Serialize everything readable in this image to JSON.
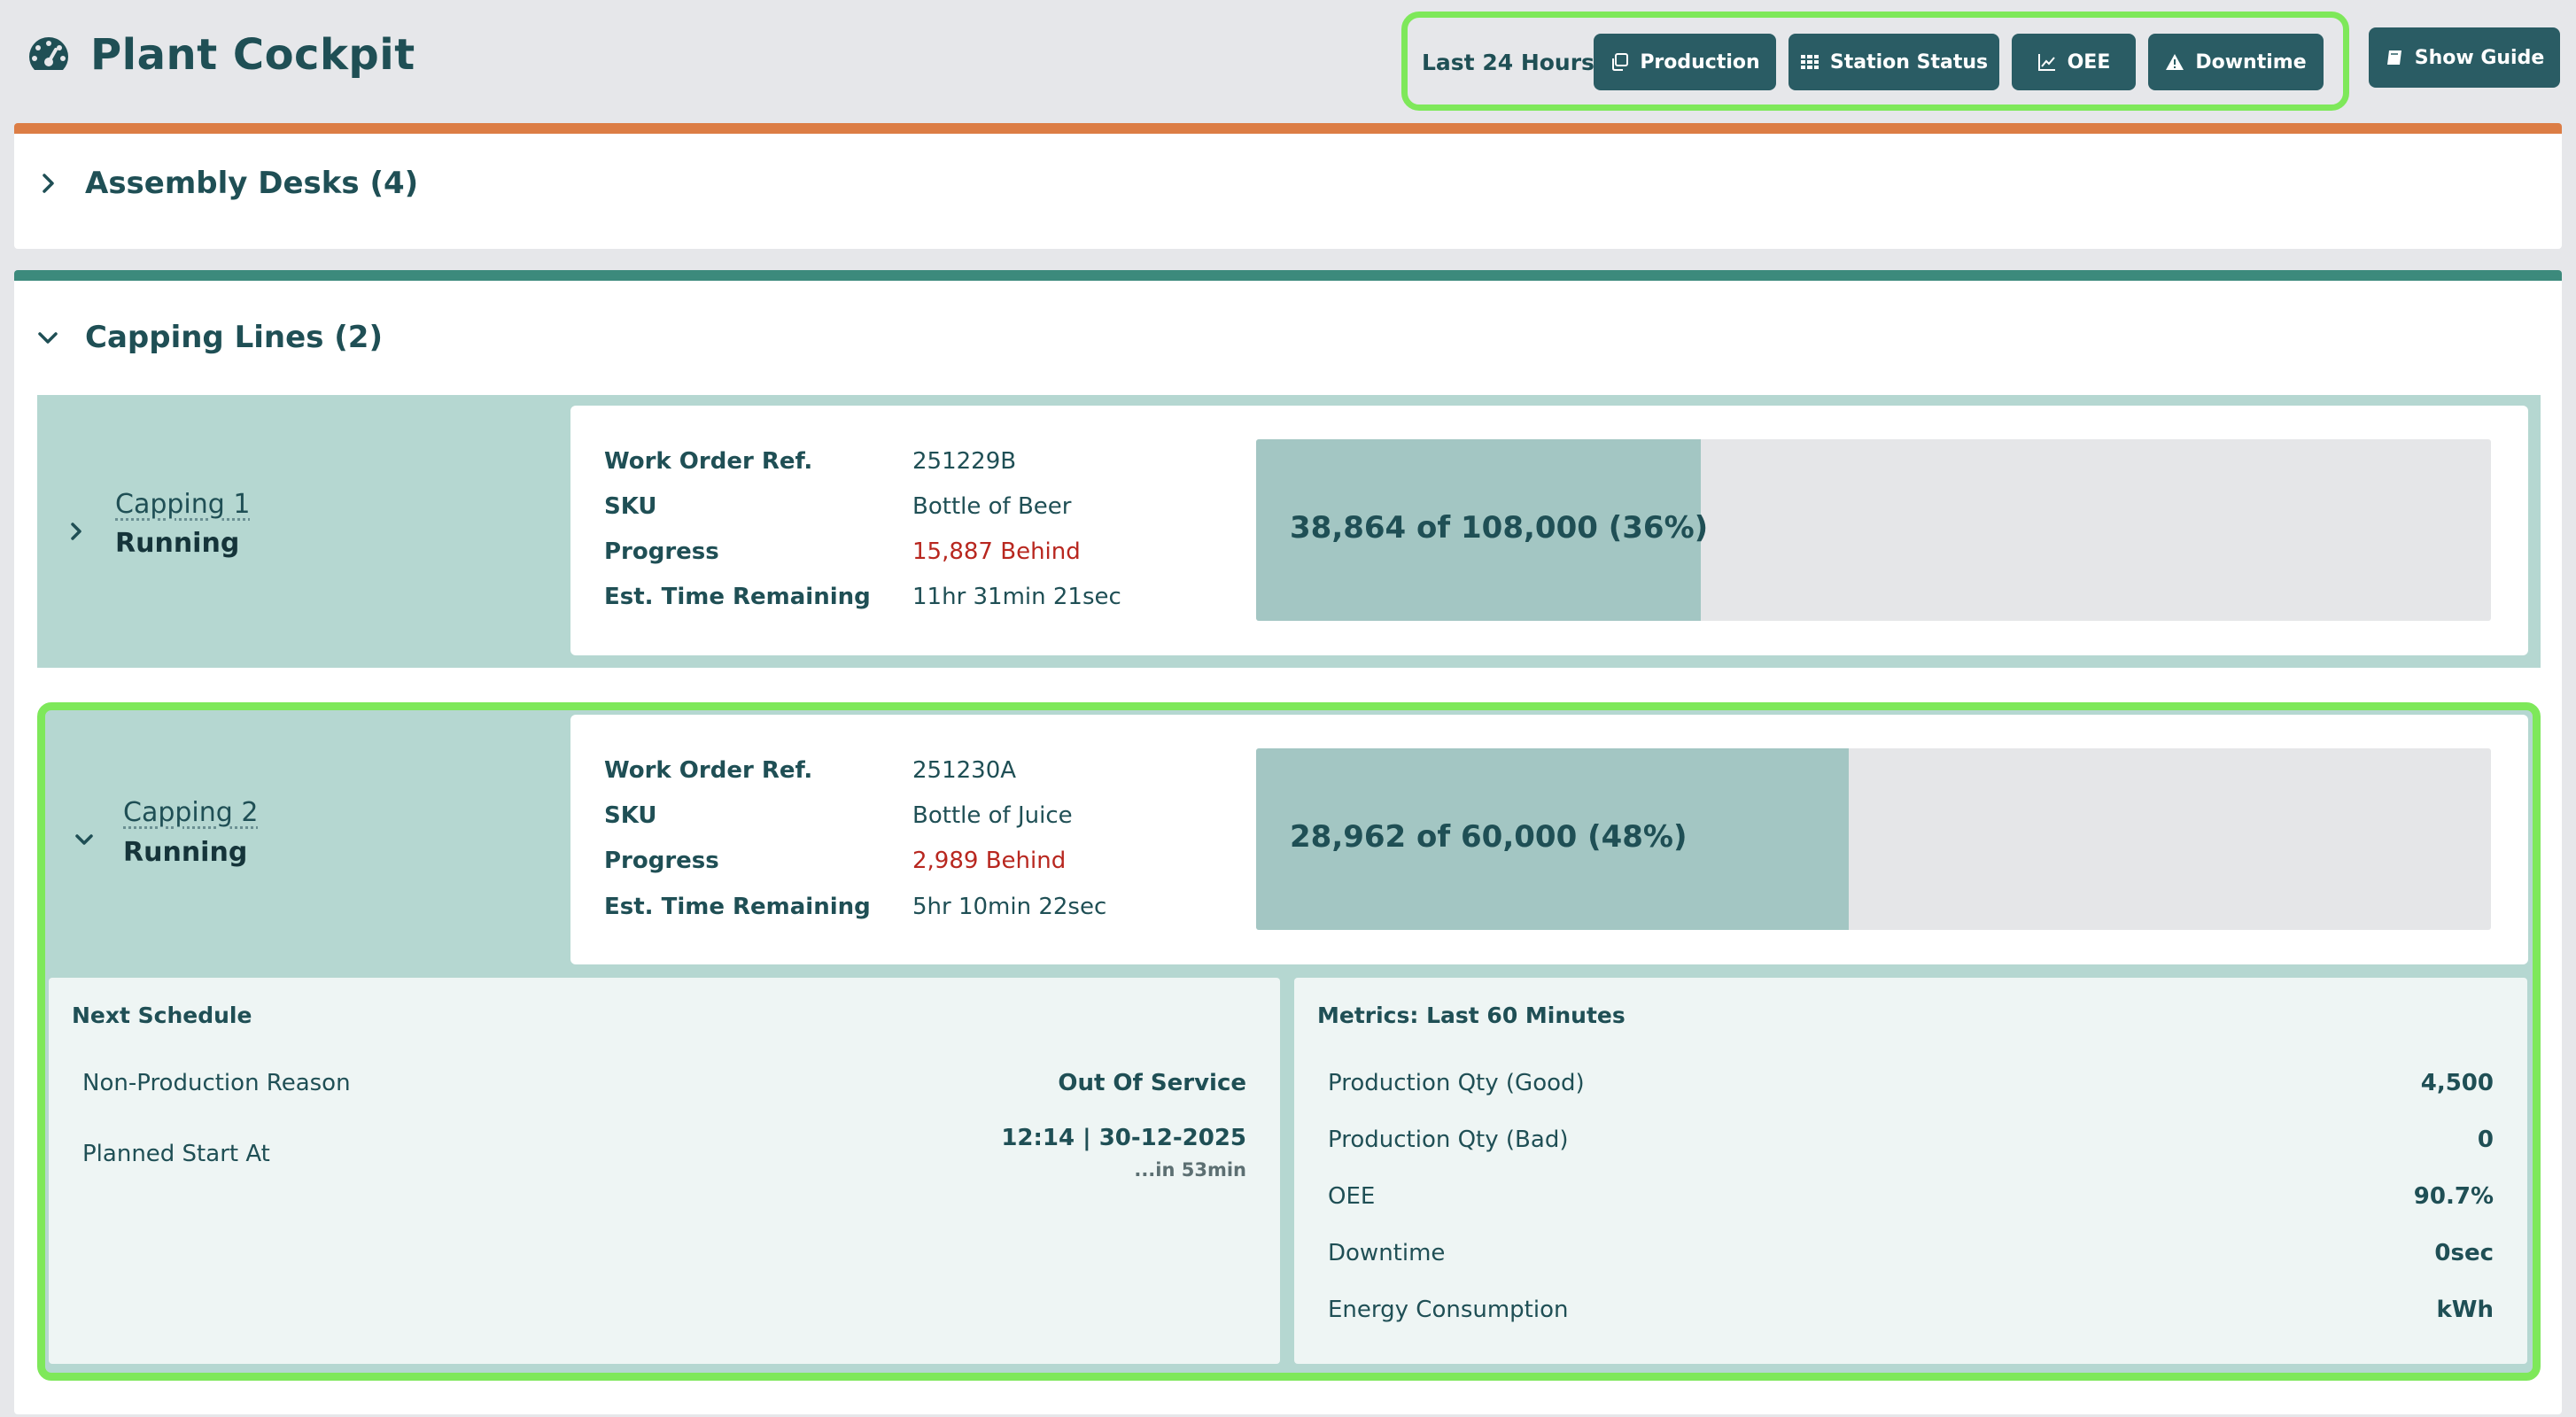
{
  "header": {
    "title": "Plant Cockpit",
    "title_icon": "gauge-icon",
    "hours_label": "Last 24 Hours:",
    "buttons": [
      {
        "label": "Production",
        "icon": "copy-icon"
      },
      {
        "label": "Station Status",
        "icon": "grid-icon"
      },
      {
        "label": "OEE",
        "icon": "line-chart-icon"
      },
      {
        "label": "Downtime",
        "icon": "warning-icon"
      }
    ],
    "guide_label": "Show Guide",
    "guide_icon": "book-icon"
  },
  "colors": {
    "brand": "#2a5c64",
    "assembly_accent": "#dc7d45",
    "capping_accent": "#3c8a7c",
    "highlight": "#7ee85a",
    "behind": "#b8271f",
    "station_bg": "#b5d7d1",
    "progress_fill": "#a3c6c3"
  },
  "sections": {
    "assembly": {
      "title": "Assembly Desks (4)",
      "expanded": false
    },
    "capping": {
      "title": "Capping Lines (2)",
      "expanded": true
    }
  },
  "wo_labels": {
    "work_order": "Work Order Ref.",
    "sku": "SKU",
    "progress": "Progress",
    "eta": "Est. Time Remaining"
  },
  "stations": [
    {
      "name": "Capping 1",
      "status": "Running",
      "expanded": false,
      "work_order": "251229B",
      "sku": "Bottle of Beer",
      "progress": "15,887 Behind",
      "eta": "11hr 31min 21sec",
      "bar_text": "38,864 of 108,000 (36%)",
      "bar_fraction": 0.36
    },
    {
      "name": "Capping 2",
      "status": "Running",
      "expanded": true,
      "work_order": "251230A",
      "sku": "Bottle of Juice",
      "progress": "2,989 Behind",
      "eta": "5hr 10min 22sec",
      "bar_text": "28,962 of 60,000 (48%)",
      "bar_fraction": 0.48
    }
  ],
  "next_schedule": {
    "title": "Next Schedule",
    "reason_label": "Non-Production Reason",
    "reason_value": "Out Of Service",
    "start_label": "Planned Start At",
    "start_value": "12:14 | 30-12-2025",
    "start_sub": "...in 53min"
  },
  "metrics": {
    "title": "Metrics: Last 60 Minutes",
    "rows": [
      {
        "label": "Production Qty (Good)",
        "value": "4,500"
      },
      {
        "label": "Production Qty (Bad)",
        "value": "0"
      },
      {
        "label": "OEE",
        "value": "90.7%"
      },
      {
        "label": "Downtime",
        "value": "0sec"
      },
      {
        "label": "Energy Consumption",
        "value": "kWh"
      }
    ]
  }
}
